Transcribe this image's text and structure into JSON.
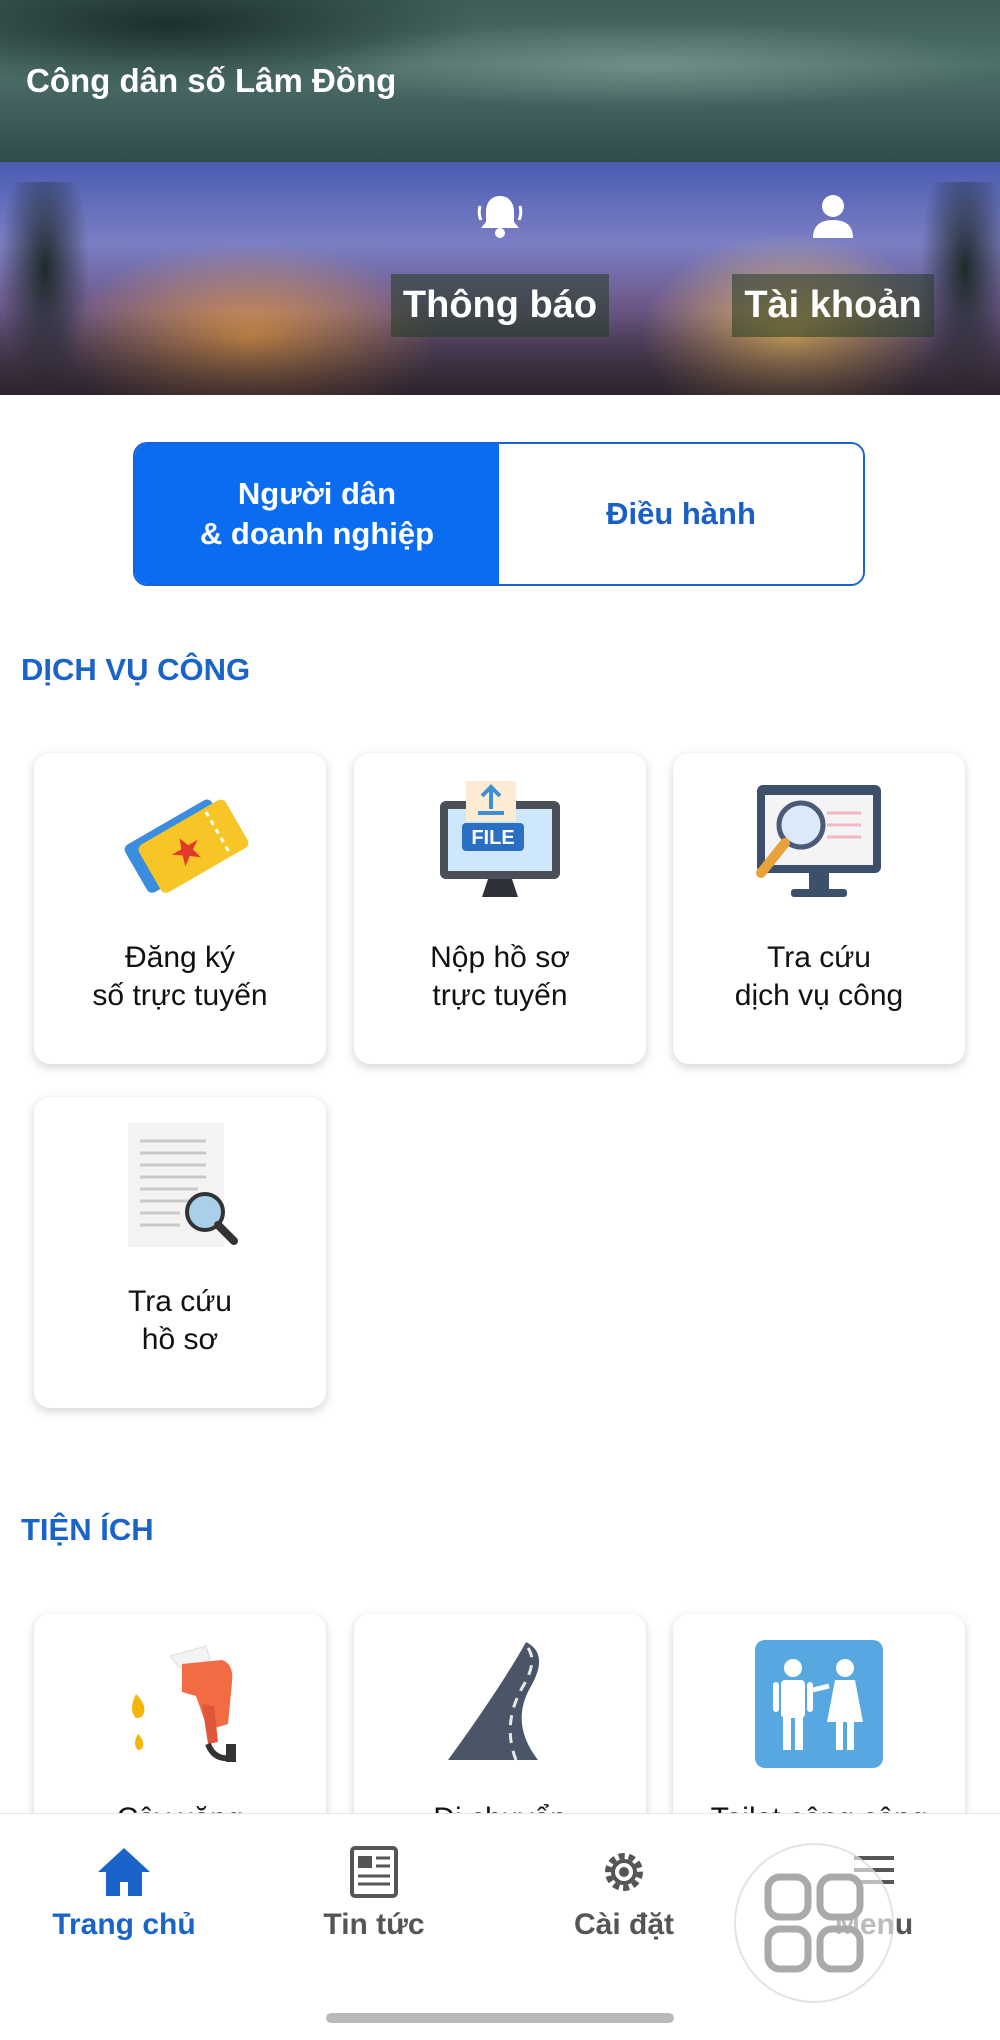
{
  "header": {
    "title": "Công dân số Lâm Đồng"
  },
  "banner": {
    "notifications_label": "Thông báo",
    "account_label": "Tài khoản"
  },
  "segment": {
    "citizen_label": "Người dân\n& doanh nghiệp",
    "admin_label": "Điều hành",
    "selected": "citizen"
  },
  "public_services": {
    "title": "DỊCH VỤ CÔNG",
    "items": [
      {
        "label": "Đăng ký\nsố trực tuyến",
        "icon": "ticket-icon"
      },
      {
        "label": "Nộp hồ sơ\ntrực tuyến",
        "icon": "file-upload-icon",
        "icon_text": "FILE"
      },
      {
        "label": "Tra cứu\ndịch vụ công",
        "icon": "monitor-search-icon"
      },
      {
        "label": "Tra cứu\nhồ sơ",
        "icon": "document-search-icon"
      }
    ]
  },
  "utilities": {
    "title": "TIỆN ÍCH",
    "items": [
      {
        "label": "Cây xăng",
        "icon": "fuel-pump-icon"
      },
      {
        "label": "Di chuyển",
        "icon": "road-icon"
      },
      {
        "label": "Toilet công cộng",
        "icon": "toilet-icon"
      }
    ]
  },
  "bottom_nav": {
    "items": [
      {
        "label": "Trang chủ",
        "icon": "home-icon",
        "active": true
      },
      {
        "label": "Tin tức",
        "icon": "news-icon",
        "active": false
      },
      {
        "label": "Cài đặt",
        "icon": "gear-icon",
        "active": false
      },
      {
        "label": "Menu",
        "icon": "menu-icon",
        "active": false
      }
    ]
  },
  "colors": {
    "accent": "#0a6cf0",
    "section_title": "#1a63c8",
    "nav_active": "#1a63c8"
  }
}
